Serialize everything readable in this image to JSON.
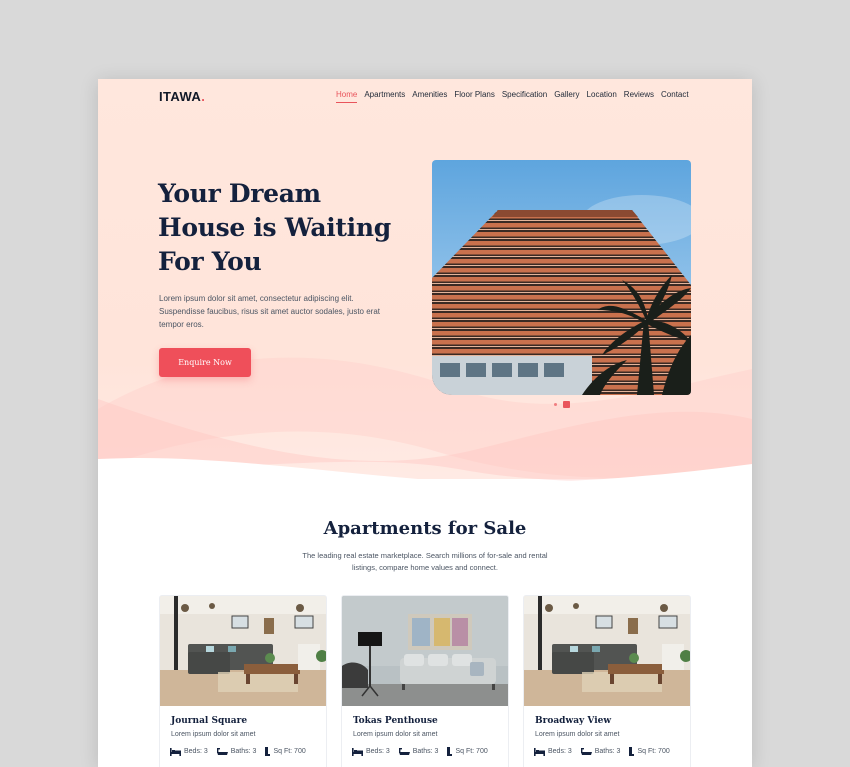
{
  "header": {
    "logo": "ITAWA",
    "logo_dot": ".",
    "nav": [
      "Home",
      "Apartments",
      "Amenities",
      "Floor Plans",
      "Specification",
      "Gallery",
      "Location",
      "Reviews",
      "Contact"
    ],
    "active_nav": "Home"
  },
  "hero": {
    "title": "Your Dream House is Waiting For You",
    "description": "Lorem ipsum dolor sit amet, consectetur adipiscing elit. Suspendisse faucibus, risus sit amet auctor sodales, justo erat tempor eros.",
    "button": "Enquire Now",
    "slider": {
      "count": 2,
      "active_index": 1
    }
  },
  "section": {
    "title": "Apartments for Sale",
    "description": "The leading real estate marketplace. Search millions of for-sale and rental listings, compare home values and connect."
  },
  "cards": [
    {
      "title": "Journal Square",
      "subtitle": "Lorem ipsum dolor sit amet",
      "beds": "Beds: 3",
      "baths": "Baths: 3",
      "sqft": "Sq Ft: 700"
    },
    {
      "title": "Tokas Penthouse",
      "subtitle": "Lorem ipsum dolor sit amet",
      "beds": "Beds: 3",
      "baths": "Baths: 3",
      "sqft": "Sq Ft: 700"
    },
    {
      "title": "Broadway View",
      "subtitle": "Lorem ipsum dolor sit amet",
      "beds": "Beds: 3",
      "baths": "Baths: 3",
      "sqft": "Sq Ft: 700"
    }
  ],
  "icons": {
    "beds": "bed-icon",
    "baths": "bathtub-icon",
    "sqft": "area-icon"
  },
  "colors": {
    "accent": "#ef4f5a",
    "heading": "#14213d",
    "hero_background": "#ffe7dd",
    "body_text": "#4b5563"
  }
}
